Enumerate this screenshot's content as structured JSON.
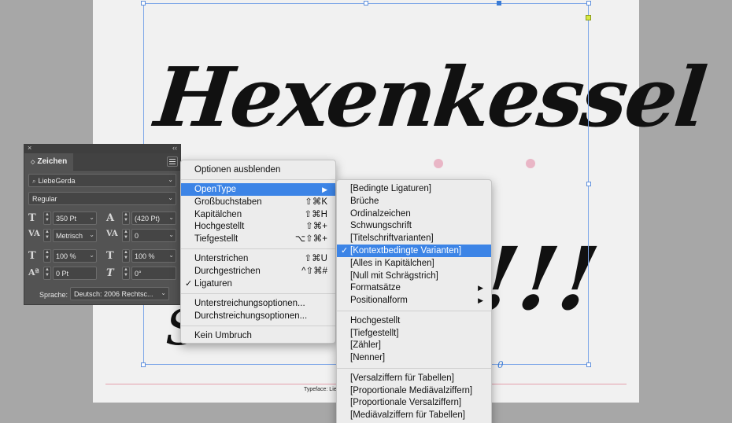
{
  "document": {
    "headline": "Hexenkessel",
    "exclamation": "!!!",
    "exclamation_lead": "l",
    "bottom_fragment": "S",
    "typeface_caption": "Typeface: Lieb",
    "thread_marker": "0"
  },
  "panel": {
    "close_glyph": "×",
    "collapse_glyph": "‹‹",
    "tab_label": "Zeichen",
    "font_family": "LiebeGerda",
    "font_style": "Regular",
    "font_size": "350 Pt",
    "leading": "(420 Pt)",
    "kerning": "Metrisch",
    "tracking": "0",
    "vertical_scale": "100 %",
    "horizontal_scale": "100 %",
    "baseline_shift": "0 Pt",
    "skew": "0°",
    "language_label": "Sprache:",
    "language": "Deutsch: 2006 Rechtsc..."
  },
  "context_menu": {
    "items": [
      {
        "label": "Optionen ausblenden",
        "shortcut": "",
        "checked": false,
        "submenu": false
      },
      {
        "label": "OpenType",
        "shortcut": "",
        "checked": false,
        "submenu": true
      },
      {
        "label": "Großbuchstaben",
        "shortcut": "⇧⌘K",
        "checked": false,
        "submenu": false
      },
      {
        "label": "Kapitälchen",
        "shortcut": "⇧⌘H",
        "checked": false,
        "submenu": false
      },
      {
        "label": "Hochgestellt",
        "shortcut": "⇧⌘+",
        "checked": false,
        "submenu": false
      },
      {
        "label": "Tiefgestellt",
        "shortcut": "⌥⇧⌘+",
        "checked": false,
        "submenu": false
      },
      {
        "label": "Unterstrichen",
        "shortcut": "⇧⌘U",
        "checked": false,
        "submenu": false
      },
      {
        "label": "Durchgestrichen",
        "shortcut": "^⇧⌘#",
        "checked": false,
        "submenu": false
      },
      {
        "label": "Ligaturen",
        "shortcut": "",
        "checked": true,
        "submenu": false
      },
      {
        "label": "Unterstreichungsoptionen...",
        "shortcut": "",
        "checked": false,
        "submenu": false
      },
      {
        "label": "Durchstreichungsoptionen...",
        "shortcut": "",
        "checked": false,
        "submenu": false
      },
      {
        "label": "Kein Umbruch",
        "shortcut": "",
        "checked": false,
        "submenu": false
      }
    ],
    "submenu_arrow": "▶"
  },
  "opentype_submenu": {
    "items": [
      {
        "label": "[Bedingte Ligaturen]",
        "checked": false,
        "submenu": false
      },
      {
        "label": "Brüche",
        "checked": false,
        "submenu": false
      },
      {
        "label": "Ordinalzeichen",
        "checked": false,
        "submenu": false
      },
      {
        "label": "Schwungschrift",
        "checked": false,
        "submenu": false
      },
      {
        "label": "[Titelschriftvarianten]",
        "checked": false,
        "submenu": false
      },
      {
        "label": "[Kontextbedingte Varianten]",
        "checked": true,
        "submenu": false
      },
      {
        "label": "[Alles in Kapitälchen]",
        "checked": false,
        "submenu": false
      },
      {
        "label": "[Null mit Schrägstrich]",
        "checked": false,
        "submenu": false
      },
      {
        "label": "Formatsätze",
        "checked": false,
        "submenu": true
      },
      {
        "label": "Positionalform",
        "checked": false,
        "submenu": true
      },
      {
        "label": "Hochgestellt",
        "checked": false,
        "submenu": false
      },
      {
        "label": "[Tiefgestellt]",
        "checked": false,
        "submenu": false
      },
      {
        "label": "[Zähler]",
        "checked": false,
        "submenu": false
      },
      {
        "label": "[Nenner]",
        "checked": false,
        "submenu": false
      },
      {
        "label": "[Versalziffern für Tabellen]",
        "checked": false,
        "submenu": false
      },
      {
        "label": "[Proportionale Mediävalziffern]",
        "checked": false,
        "submenu": false
      },
      {
        "label": "[Proportionale Versalziffern]",
        "checked": false,
        "submenu": false
      },
      {
        "label": "[Mediävalziffern für Tabellen]",
        "checked": false,
        "submenu": false
      }
    ],
    "check_glyph": "✓",
    "submenu_arrow": "▶"
  },
  "colors": {
    "highlight": "#3c84e6",
    "frame_border": "#7ea7e8",
    "panel_bg": "#535353",
    "pink_dots": "#e9b6c6"
  }
}
